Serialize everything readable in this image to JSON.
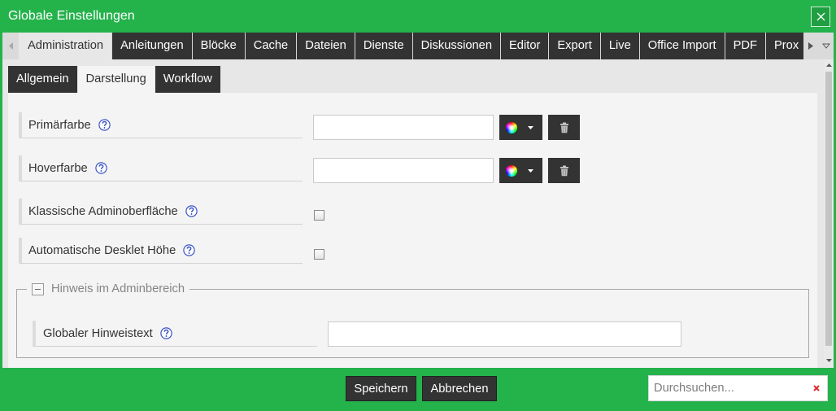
{
  "window": {
    "title": "Globale Einstellungen",
    "close_icon": "close-icon"
  },
  "colors": {
    "brand": "#24b24b",
    "tab_dark": "#333333",
    "help": "#3b55c4",
    "clear": "#e02a2a"
  },
  "tabs": {
    "prev_icon": "triangle-left-icon",
    "next_icon": "triangle-right-icon",
    "menu_icon": "chevron-down-icon",
    "items": [
      {
        "label": "Administration",
        "active": true
      },
      {
        "label": "Anleitungen",
        "active": false
      },
      {
        "label": "Blöcke",
        "active": false
      },
      {
        "label": "Cache",
        "active": false
      },
      {
        "label": "Dateien",
        "active": false
      },
      {
        "label": "Dienste",
        "active": false
      },
      {
        "label": "Diskussionen",
        "active": false
      },
      {
        "label": "Editor",
        "active": false
      },
      {
        "label": "Export",
        "active": false
      },
      {
        "label": "Live",
        "active": false
      },
      {
        "label": "Office Import",
        "active": false
      },
      {
        "label": "PDF",
        "active": false
      },
      {
        "label": "Prox",
        "active": false
      }
    ]
  },
  "subtabs": {
    "items": [
      {
        "label": "Allgemein",
        "active": false
      },
      {
        "label": "Darstellung",
        "active": true
      },
      {
        "label": "Workflow",
        "active": false
      }
    ]
  },
  "settings": {
    "primaerfarbe": {
      "label": "Primärfarbe",
      "help_icon": "help-icon",
      "value": "",
      "picker_icon": "color-wheel-icon",
      "clear_icon": "trash-icon"
    },
    "hoverfarbe": {
      "label": "Hoverfarbe",
      "help_icon": "help-icon",
      "value": "",
      "picker_icon": "color-wheel-icon",
      "clear_icon": "trash-icon"
    },
    "klassische_adminoberflaeche": {
      "label": "Klassische Adminoberfläche",
      "help_icon": "help-icon",
      "checked": false
    },
    "automatische_desklet_hoehe": {
      "label": "Automatische Desklet Höhe",
      "help_icon": "help-icon",
      "checked": false
    }
  },
  "hinweis": {
    "legend": "Hinweis im Adminbereich",
    "collapse_icon": "collapse-icon",
    "expanded": true,
    "hinweistext": {
      "label": "Globaler Hinweistext",
      "help_icon": "help-icon",
      "value": ""
    }
  },
  "footer": {
    "save_label": "Speichern",
    "cancel_label": "Abbrechen",
    "search": {
      "placeholder": "Durchsuchen...",
      "value": "",
      "clear_icon": "clear-icon"
    }
  }
}
